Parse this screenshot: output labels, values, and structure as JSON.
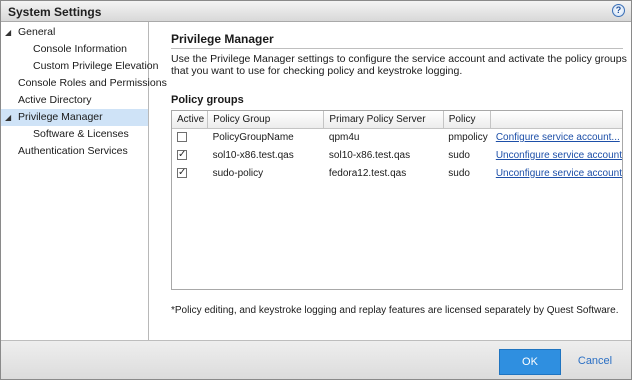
{
  "window": {
    "title": "System Settings",
    "help_label": "?"
  },
  "sidebar": {
    "items": [
      {
        "label": "General",
        "expanded": true
      },
      {
        "label": "Console Information"
      },
      {
        "label": "Custom Privilege Elevation"
      },
      {
        "label": "Console Roles and Permissions"
      },
      {
        "label": "Active Directory"
      },
      {
        "label": "Privilege Manager",
        "expanded": true,
        "selected": true
      },
      {
        "label": "Software & Licenses"
      },
      {
        "label": "Authentication Services"
      }
    ]
  },
  "main": {
    "title": "Privilege Manager",
    "description": "Use the Privilege Manager settings to configure the service account and activate the policy groups that you want to use for checking policy and keystroke logging.",
    "policy_groups_label": "Policy groups",
    "table": {
      "columns": [
        "Active",
        "Policy Group",
        "Primary Policy Server",
        "Policy",
        ""
      ],
      "rows": [
        {
          "active": false,
          "group": "PolicyGroupName",
          "server": "qpm4u",
          "policy": "pmpolicy",
          "action": "Configure service account..."
        },
        {
          "active": true,
          "group": "sol10-x86.test.qas",
          "server": "sol10-x86.test.qas",
          "policy": "sudo",
          "action": "Unconfigure service account"
        },
        {
          "active": true,
          "group": "sudo-policy",
          "server": "fedora12.test.qas",
          "policy": "sudo",
          "action": "Unconfigure service account"
        }
      ]
    },
    "footnote": "*Policy editing, and keystroke logging and replay features are licensed separately by Quest Software."
  },
  "footer": {
    "ok_label": "OK",
    "cancel_label": "Cancel"
  },
  "colors": {
    "accent": "#2f8fe0",
    "selection": "#cfe3f7",
    "link": "#1d4fa8"
  },
  "icons": {
    "expand": "triangle-down-icon",
    "help": "help-icon",
    "checkbox_checked": "checkmark-icon"
  }
}
